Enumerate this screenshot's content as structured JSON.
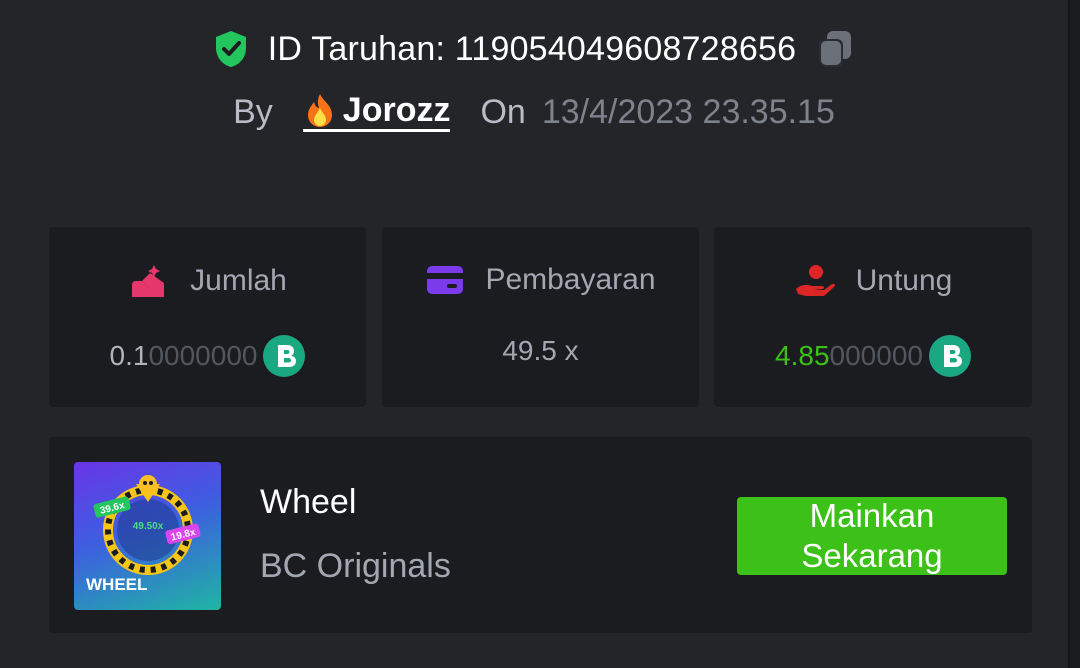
{
  "bet": {
    "id_text": "ID Taruhan: 119054049608728656",
    "by_label": "By",
    "username": "Jorozz",
    "on_label": "On",
    "datetime": "13/4/2023 23.35.15"
  },
  "stats": {
    "amount": {
      "label": "Jumlah",
      "value_main": "0.1",
      "value_dim": "0000000",
      "icon": "bet-amount-icon"
    },
    "payout": {
      "label": "Pembayaran",
      "value": "49.5 x",
      "icon": "card-icon"
    },
    "profit": {
      "label": "Untung",
      "value_main": "4.85",
      "value_dim": "000000",
      "icon": "profit-hand-icon"
    }
  },
  "game": {
    "title": "Wheel",
    "provider": "BC Originals",
    "thumbnail_text": "WHEEL",
    "thumbnail_badges": [
      "39.6x",
      "49.50x",
      "19.8x"
    ],
    "play_button_label": "Mainkan Sekarang"
  },
  "colors": {
    "background": "#232529",
    "card": "#1b1c20",
    "accent_green": "#3bc117",
    "coin_teal": "#1aa883",
    "shield_green": "#22c55e",
    "amount_icon_pink": "#e5376b",
    "payout_icon_purple": "#7c3aed",
    "profit_icon_red": "#dc2626"
  }
}
